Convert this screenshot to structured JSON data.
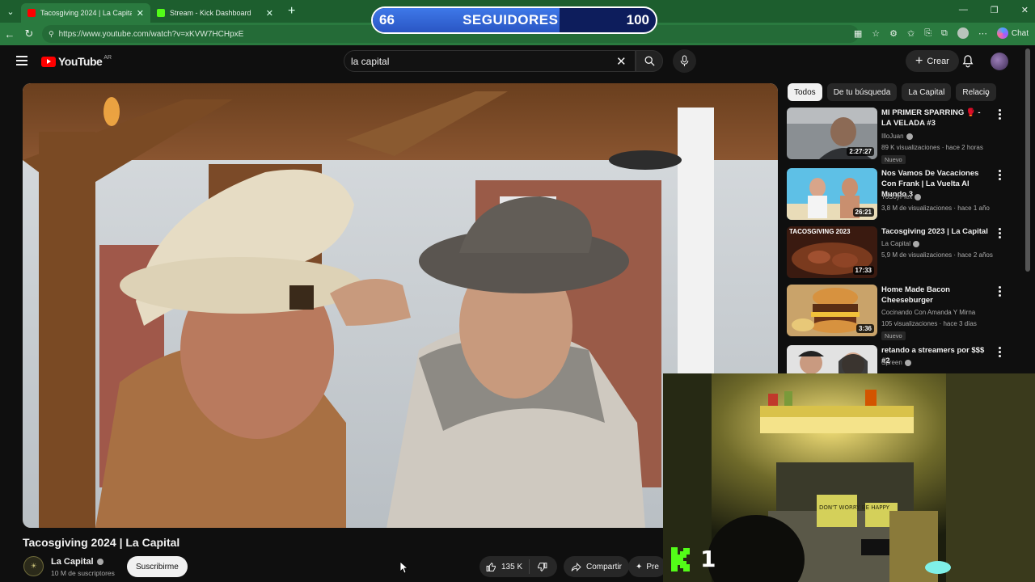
{
  "browser": {
    "tabs": [
      {
        "title": "Tacosgiving 2024 | La Capital - You",
        "active": true,
        "favicon_color": "#ff0000"
      },
      {
        "title": "Stream - Kick Dashboard",
        "active": false,
        "favicon_color": "#53fc18"
      }
    ],
    "url": "https://www.youtube.com/watch?v=xKVW7HCHpxE",
    "copilot_label": "Chat"
  },
  "followers_goal": {
    "current": "66",
    "label": "SEGUIDORES",
    "goal": "100",
    "progress": 0.66
  },
  "youtube": {
    "logo_text": "YouTube",
    "country_code": "AR",
    "search_value": "la capital",
    "create_label": "Crear"
  },
  "video": {
    "title": "Tacosgiving 2024 | La Capital",
    "channel": "La Capital",
    "subscribers": "10 M de suscriptores",
    "subscribe_label": "Suscribirme",
    "likes": "135 K",
    "share_label": "Compartir",
    "more_label": "Pre"
  },
  "sidebar": {
    "chips": [
      "Todos",
      "De tu búsqueda",
      "La Capital",
      "Relacio"
    ],
    "recommendations": [
      {
        "title": "MI PRIMER SPARRING 🥊 - LA VELADA #3",
        "channel": "IlloJuan",
        "meta": "89 K visualizaciones · hace 2 horas",
        "duration": "2:27:27",
        "badge": "Nuevo",
        "thumb_color": "#8a8f93"
      },
      {
        "title": "Nos Vamos De Vacaciones Con Frank | La Vuelta Al Mundo 3",
        "channel": "YoSoyPlex",
        "meta": "3,8 M de visualizaciones · hace 1 año",
        "duration": "26:21",
        "badge": "",
        "thumb_color": "#4fb3d9"
      },
      {
        "title": "Tacosgiving 2023 | La Capital",
        "channel": "La Capital",
        "meta": "5,9 M de visualizaciones · hace 2 años",
        "duration": "17:33",
        "badge": "",
        "thumb_text": "TACOSGIVING 2023",
        "thumb_color": "#5a2a1a"
      },
      {
        "title": "Home Made Bacon Cheeseburger",
        "channel": "Cocinando Con Amanda Y Mirna",
        "meta": "105 visualizaciones · hace 3 días",
        "duration": "3:36",
        "badge": "Nuevo",
        "thumb_color": "#a5702f"
      },
      {
        "title": "retando a streamers por $$$ #2",
        "channel": "Spreen",
        "meta": "",
        "duration": "",
        "badge": "",
        "thumb_color": "#d8d8d8"
      }
    ]
  },
  "kick": {
    "viewer_count": "1",
    "accent_color": "#53fc18"
  },
  "webcam_sign_text": "DON'T WORRY BE HAPPY"
}
